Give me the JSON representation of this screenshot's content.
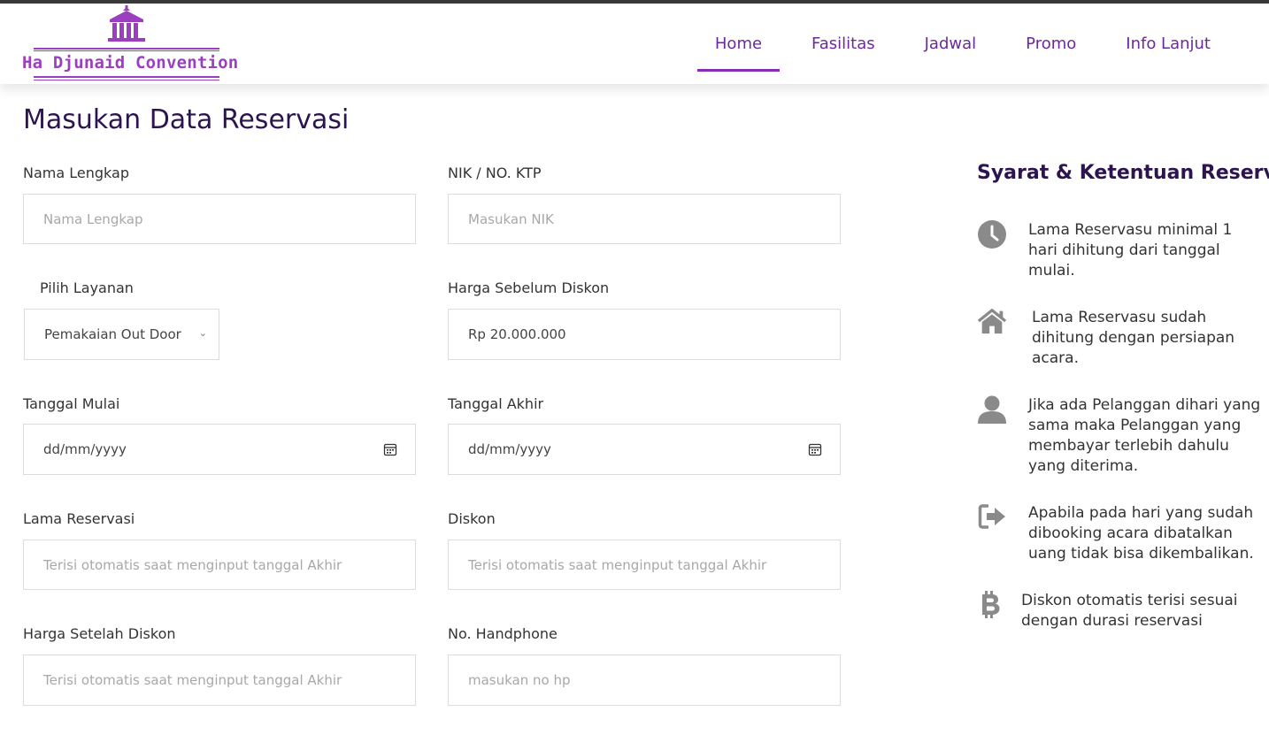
{
  "brand": {
    "name": "Ha Djunaid Convention",
    "color": "#9b3fc0"
  },
  "nav": {
    "items": [
      {
        "label": "Home",
        "active": true
      },
      {
        "label": "Fasilitas",
        "active": false
      },
      {
        "label": "Jadwal",
        "active": false
      },
      {
        "label": "Promo",
        "active": false
      },
      {
        "label": "Info Lanjut",
        "active": false
      }
    ],
    "accent": "#8a2bb5"
  },
  "page": {
    "title": "Masukan Data Reservasi"
  },
  "form": {
    "nama": {
      "label": "Nama Lengkap",
      "placeholder": "Nama Lengkap"
    },
    "nik": {
      "label": "NIK / NO. KTP",
      "placeholder": "Masukan NIK"
    },
    "layanan": {
      "label": "Pilih Layanan",
      "value": "Pemakaian Out Door"
    },
    "harga_sebelum": {
      "label": "Harga Sebelum Diskon",
      "value": "Rp 20.000.000"
    },
    "tanggal_mulai": {
      "label": "Tanggal Mulai",
      "value": "dd/mm/yyyy"
    },
    "tanggal_akhir": {
      "label": "Tanggal Akhir",
      "value": "dd/mm/yyyy"
    },
    "lama": {
      "label": "Lama Reservasi",
      "placeholder": "Terisi otomatis saat menginput tanggal Akhir"
    },
    "diskon": {
      "label": "Diskon",
      "placeholder": "Terisi otomatis saat menginput tanggal Akhir"
    },
    "harga_setelah": {
      "label": "Harga Setelah Diskon",
      "placeholder": "Terisi otomatis saat menginput tanggal Akhir"
    },
    "hp": {
      "label": "No. Handphone",
      "placeholder": "masukan no hp"
    }
  },
  "terms": {
    "title": "Syarat & Ketentuan Reservasu",
    "items": [
      {
        "icon": "clock-icon",
        "text": "Lama Reservasu minimal 1 hari dihitung dari tanggal mulai."
      },
      {
        "icon": "home-icon",
        "text": "Lama Reservasu sudah dihitung dengan persiapan acara."
      },
      {
        "icon": "user-icon",
        "text": "Jika ada Pelanggan dihari yang sama maka Pelanggan yang membayar terlebih dahulu yang diterima."
      },
      {
        "icon": "sign-out-icon",
        "text": "Apabila pada hari yang sudah dibooking acara dibatalkan uang tidak bisa dikembalikan."
      },
      {
        "icon": "bitcoin-icon",
        "text": "Diskon otomatis terisi sesuai dengan durasi reservasi"
      }
    ],
    "icon_color": "#8a8a8a"
  }
}
